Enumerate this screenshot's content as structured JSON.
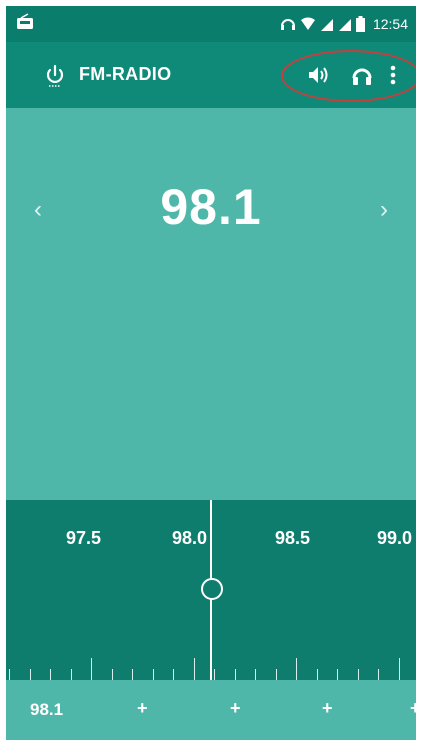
{
  "status_bar": {
    "time": "12:54"
  },
  "toolbar": {
    "title": "FM-RADIO"
  },
  "display": {
    "frequency": "98.1",
    "prev_arrow": "‹",
    "next_arrow": "›"
  },
  "tuner": {
    "labels": [
      "97.5",
      "98.0",
      "98.5",
      "99.0"
    ]
  },
  "favorites": {
    "first": "98.1",
    "placeholders": [
      "+",
      "+",
      "+",
      "+"
    ]
  },
  "colors": {
    "status_bar": "#0b7d6d",
    "toolbar": "#0f8a78",
    "background": "#4fb7aa",
    "tuner": "#0f7d6e",
    "highlight": "#c63f3f"
  },
  "icons": {
    "status_left": "radio-icon",
    "headset": "headset-icon",
    "wifi": "wifi-icon",
    "signal": "signal-icon",
    "battery": "battery-icon",
    "power": "power-icon",
    "speaker": "speaker-icon",
    "more": "more-icon"
  }
}
